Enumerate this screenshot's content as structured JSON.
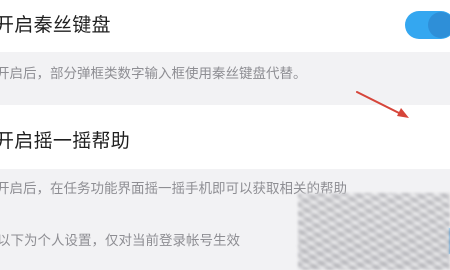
{
  "settings": [
    {
      "title": "开启秦丝键盘",
      "description": "开启后，部分弹框类数字输入框使用秦丝键盘代替。",
      "enabled": true
    },
    {
      "title": "开启摇一摇帮助",
      "description": "开启后，在任务功能界面摇一摇手机即可以获取相关的帮助",
      "enabled": true
    }
  ],
  "footer_note": "以下为个人设置，仅对当前登录帐号生效",
  "colors": {
    "toggle_on": "#34a7f0",
    "arrow": "#d6453a"
  }
}
